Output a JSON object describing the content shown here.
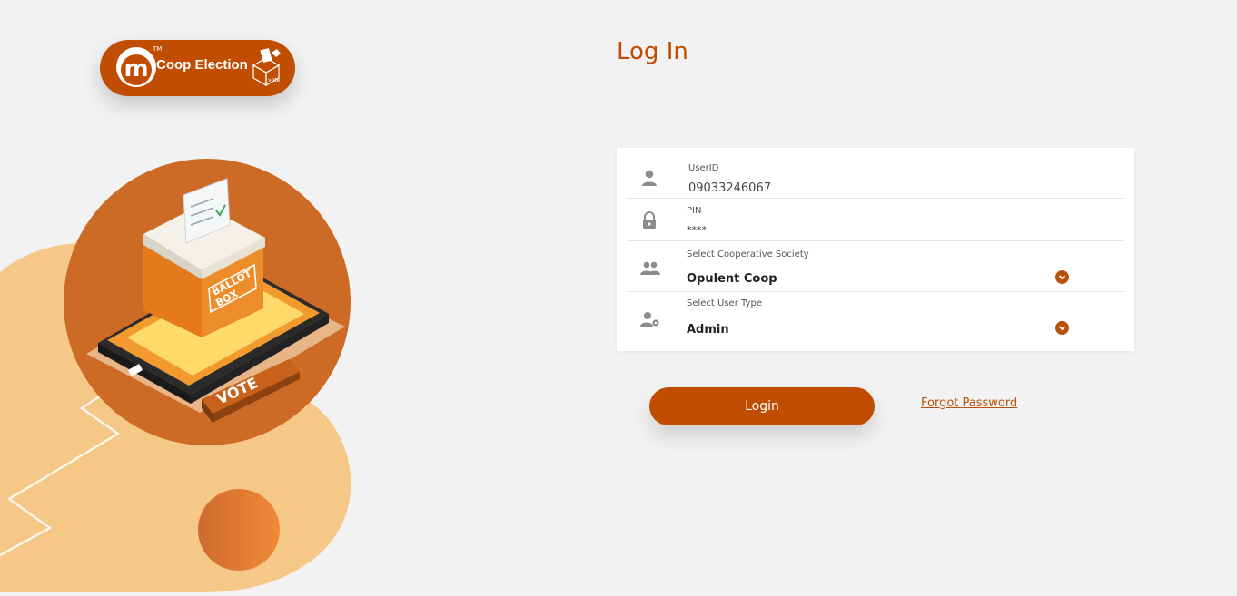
{
  "brand": {
    "logo_letter": "m",
    "logo_tm": "TM",
    "logo_text": "Coop Election",
    "logo_box_label": "vote",
    "color": "#c04d02"
  },
  "illustration": {
    "ballot_label_line1": "BALLOT",
    "ballot_label_line2": "BOX",
    "vote_label": "VOTE"
  },
  "login": {
    "title": "Log In",
    "fields": [
      {
        "label": "UserID",
        "value": "09033246067",
        "icon": "user-icon"
      },
      {
        "label": "PIN",
        "value": "****",
        "icon": "lock-icon"
      },
      {
        "label": "Select Cooperative Society",
        "value": "Opulent Coop",
        "icon": "group-icon"
      },
      {
        "label": "Select User Type",
        "value": "Admin",
        "icon": "user-settings-icon"
      }
    ],
    "submit_label": "Login",
    "forgot_label": "Forgot Password"
  }
}
